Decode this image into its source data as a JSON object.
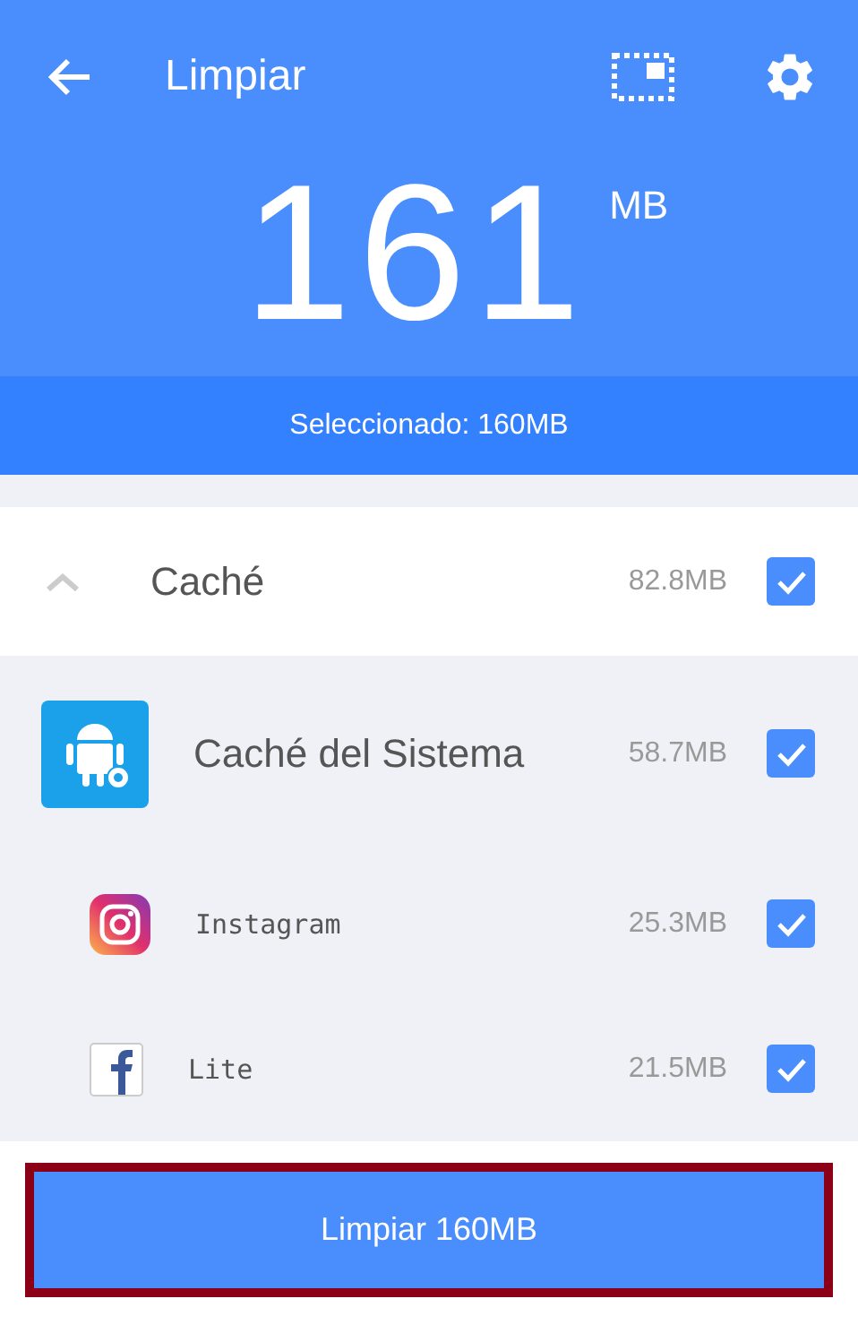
{
  "header": {
    "title": "Limpiar",
    "total": "161",
    "unit": "MB",
    "selected_label": "Seleccionado: 160MB"
  },
  "group": {
    "name": "Caché",
    "size": "82.8MB",
    "expanded": true,
    "checked": true,
    "items": [
      {
        "kind": "system",
        "name": "Caché del Sistema",
        "size": "58.7MB",
        "checked": true
      },
      {
        "kind": "camera",
        "name": "Instagram",
        "size": "25.3MB",
        "checked": true
      },
      {
        "kind": "letter-f",
        "name": "Lite",
        "size": "21.5MB",
        "checked": true
      }
    ]
  },
  "button": "Limpiar 160MB"
}
